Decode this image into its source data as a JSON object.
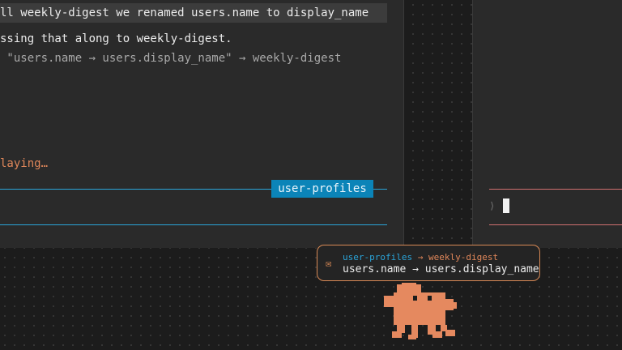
{
  "messages": [
    {
      "text": "ll weekly-digest we renamed users.name to display_name"
    },
    {
      "text": "ssing that along to weekly-digest."
    },
    {
      "text": " \"users.name → users.display_name\" → weekly-digest"
    }
  ],
  "status": {
    "text": "laying…",
    "color": "#e0875a"
  },
  "pane": {
    "label": "user-profiles",
    "accent": "#0b84b8"
  },
  "right_pane": {
    "prompt": "⟩",
    "accent": "#d07070"
  },
  "notification": {
    "icon": "envelope-icon",
    "from": "user-profiles",
    "arrow": "→",
    "to": "weekly-digest",
    "text": "users.name → users.display_name",
    "border_color": "#d88955"
  },
  "mascot": {
    "icon": "pixel-creature-icon",
    "color": "#e5895f"
  }
}
